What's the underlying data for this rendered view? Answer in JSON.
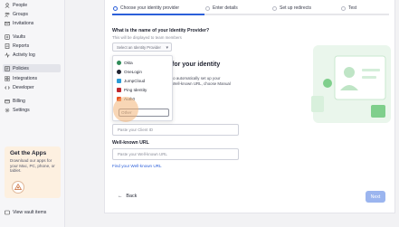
{
  "sidebar": {
    "items": [
      {
        "label": "People",
        "icon": "person-icon"
      },
      {
        "label": "Groups",
        "icon": "groups-icon"
      },
      {
        "label": "Invitations",
        "icon": "mail-icon"
      },
      {
        "label": "Vaults",
        "icon": "vault-icon"
      },
      {
        "label": "Reports",
        "icon": "report-icon"
      },
      {
        "label": "Activity log",
        "icon": "activity-icon"
      },
      {
        "label": "Policies",
        "icon": "policy-icon"
      },
      {
        "label": "Integrations",
        "icon": "integrations-icon"
      },
      {
        "label": "Developer",
        "icon": "code-icon"
      },
      {
        "label": "Billing",
        "icon": "billing-icon"
      },
      {
        "label": "Settings",
        "icon": "gear-icon"
      }
    ],
    "apps_card": {
      "title": "Get the Apps",
      "description": "Download our apps for your Mac, PC, phone, or tablet."
    },
    "view_vault_items": "View vault items"
  },
  "steps": [
    {
      "label": "Choose your identity provider"
    },
    {
      "label": "Enter details"
    },
    {
      "label": "Set up redirects"
    },
    {
      "label": "Test"
    }
  ],
  "form": {
    "question": "What is the name of your Identity Provider?",
    "question_sub": "This will be displayed to team members",
    "select_placeholder": "Select an Identity Provider",
    "hero_title": "for your identity",
    "hero_desc_line1": "to automatically set up your",
    "hero_desc_line2": "Well-known URL, choose Manual",
    "client_id_placeholder": "Paste your Client ID",
    "wellknown_label": "Well-known URL",
    "wellknown_placeholder": "Paste your Well-known URL",
    "find_wellknown_link": "Find your Well-known URL",
    "back_label": "Back",
    "next_label": "Next"
  },
  "dropdown": {
    "options": [
      {
        "label": "Okta",
        "color": "#2e8b57"
      },
      {
        "label": "OneLogin",
        "color": "#1f2230"
      },
      {
        "label": "JumpCloud",
        "color": "#2b9bd6"
      },
      {
        "label": "Ping Identity",
        "color": "#c0262d"
      },
      {
        "label": "Auth0",
        "color": "#eb5424"
      }
    ],
    "other_label": "Other"
  },
  "colors": {
    "accent": "#2b5fd9",
    "next_disabled": "#9bb5ef",
    "apps_card_bg": "#fdf0e0"
  }
}
